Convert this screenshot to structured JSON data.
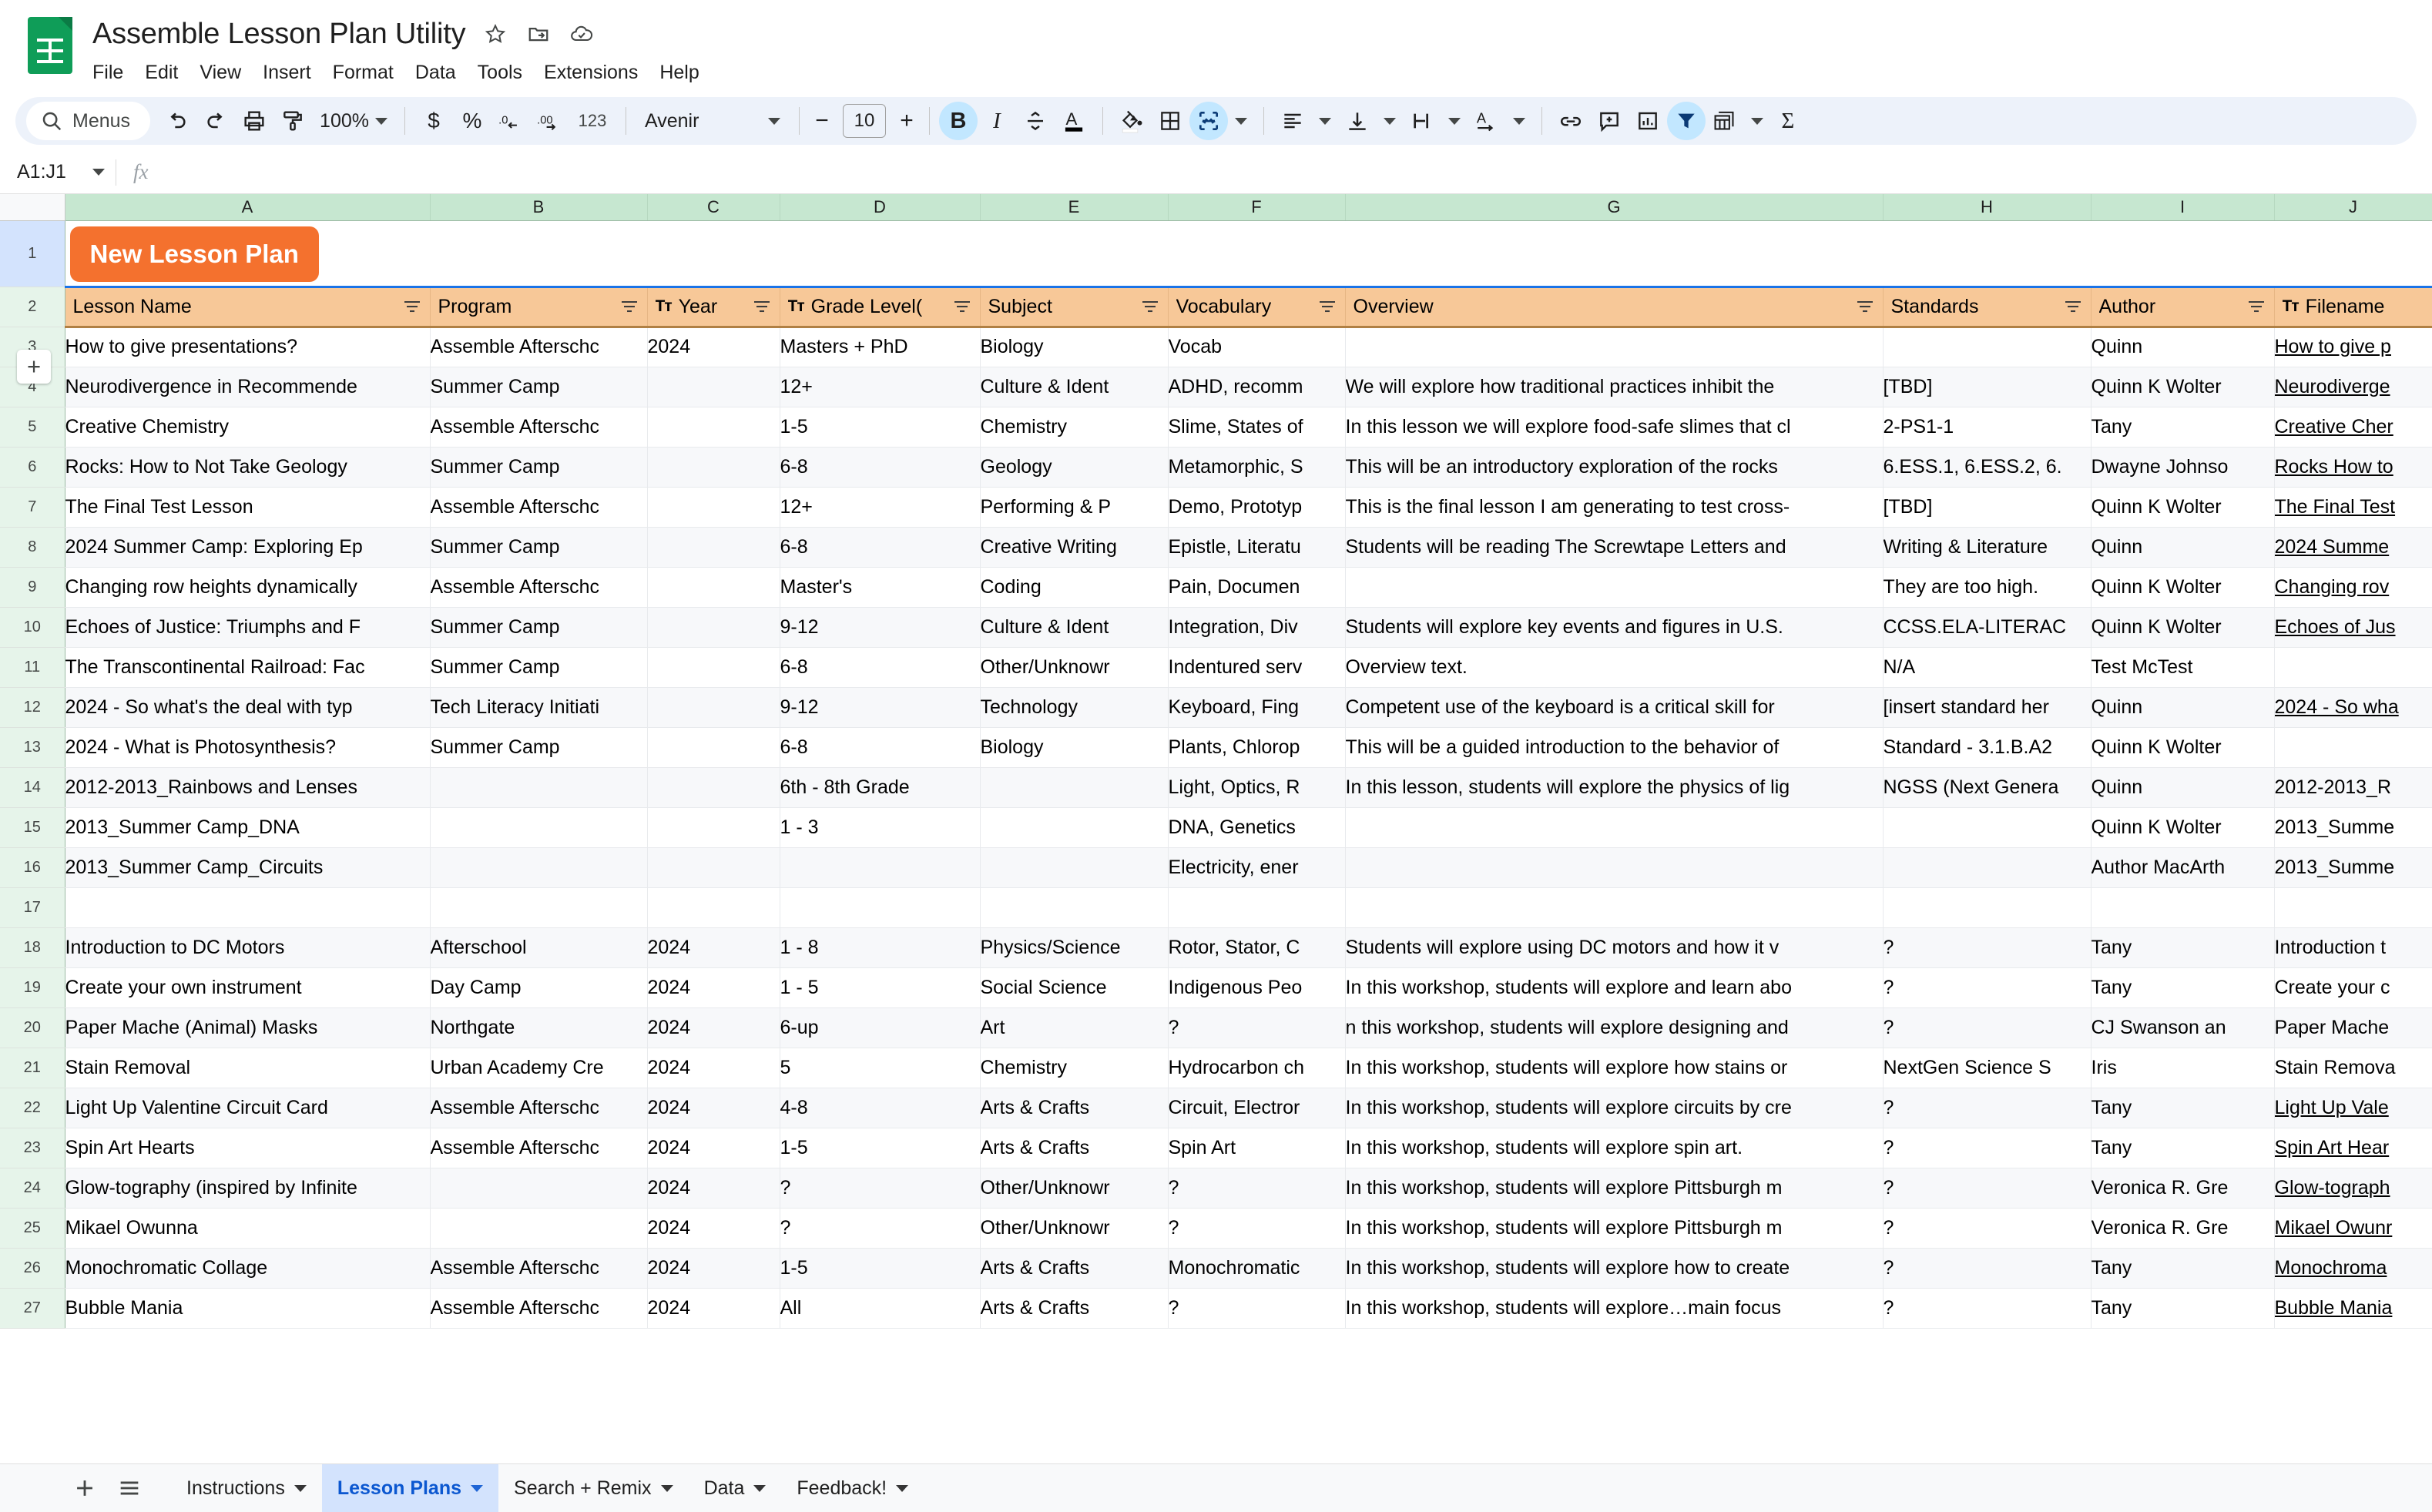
{
  "app": {
    "doc_title": "Assemble Lesson Plan Utility",
    "menus": [
      "File",
      "Edit",
      "View",
      "Insert",
      "Format",
      "Data",
      "Tools",
      "Extensions",
      "Help"
    ],
    "title_icons": [
      "star-icon",
      "move-to-folder-icon",
      "cloud-saved-icon"
    ]
  },
  "toolbar": {
    "menus_label": "Menus",
    "zoom": "100%",
    "font_family_label": "Avenir",
    "font_size": "10",
    "number_format_123": "123",
    "currency": "$",
    "percent": "%",
    "decrease_decimal": ".0",
    "increase_decimal": ".00",
    "bold": "B",
    "italic": "I",
    "bold_active": true,
    "merge_active": true,
    "filter_active": true
  },
  "formula_bar": {
    "name_box": "A1:J1",
    "fx": "fx",
    "value": ""
  },
  "grid": {
    "columns": [
      "A",
      "B",
      "C",
      "D",
      "E",
      "F",
      "G",
      "H",
      "I",
      "J"
    ],
    "banner": {
      "row_number": "1",
      "button_label": "New Lesson Plan",
      "button_color": "#F4712E",
      "button_text_color": "#ffffff"
    },
    "header": {
      "row_number": "2",
      "background": "#f7c898",
      "cells": [
        {
          "label": "Lesson Name",
          "prefix": "",
          "filter": true
        },
        {
          "label": "Program",
          "prefix": "",
          "filter": true
        },
        {
          "label": "Year",
          "prefix": "Tт",
          "filter": true
        },
        {
          "label": "Grade Level(",
          "prefix": "Tт",
          "filter": true
        },
        {
          "label": "Subject",
          "prefix": "",
          "filter": true
        },
        {
          "label": "Vocabulary",
          "prefix": "",
          "filter": true
        },
        {
          "label": "Overview",
          "prefix": "",
          "filter": true
        },
        {
          "label": "Standards",
          "prefix": "",
          "filter": true
        },
        {
          "label": "Author",
          "prefix": "",
          "filter": true
        },
        {
          "label": "Filename",
          "prefix": "Tт",
          "filter": false
        }
      ]
    },
    "rows": [
      {
        "n": "3",
        "cells": [
          "How to give presentations?",
          "Assemble Afterschc",
          "2024",
          "Masters + PhD",
          "Biology",
          "Vocab",
          "",
          "",
          "Quinn",
          "How to give p"
        ],
        "link": true
      },
      {
        "n": "4",
        "cells": [
          "Neurodivergence in Recommende",
          "Summer Camp",
          "",
          "12+",
          "Culture & Ident",
          "ADHD, recomm",
          "We will explore how traditional practices inhibit the",
          "[TBD]",
          "Quinn K Wolter",
          "Neurodiverge"
        ],
        "link": true
      },
      {
        "n": "5",
        "cells": [
          "Creative Chemistry",
          "Assemble Afterschc",
          "",
          "1-5",
          "Chemistry",
          "Slime, States of",
          "In this lesson we will explore food-safe slimes that cl",
          "2-PS1-1",
          "Tany",
          "Creative Cher"
        ],
        "link": true
      },
      {
        "n": "6",
        "cells": [
          "Rocks: How to Not Take Geology ",
          "Summer Camp",
          "",
          "6-8",
          "Geology",
          "Metamorphic, S",
          "This will be an introductory exploration of the rocks",
          "6.ESS.1, 6.ESS.2, 6.",
          "Dwayne Johnso",
          "Rocks How to"
        ],
        "link": true
      },
      {
        "n": "7",
        "cells": [
          "The Final Test Lesson",
          "Assemble Afterschc",
          "",
          "12+",
          "Performing & P",
          "Demo, Prototyp",
          "This is the final lesson I am generating to test cross-",
          "[TBD]",
          "Quinn K Wolter",
          "The Final Test"
        ],
        "link": true
      },
      {
        "n": "8",
        "cells": [
          "2024 Summer Camp: Exploring Ep",
          "Summer Camp",
          "",
          "6-8",
          "Creative Writing",
          "Epistle, Literatu",
          "Students will be reading The Screwtape Letters and",
          "Writing & Literature",
          "Quinn",
          "2024 Summe"
        ],
        "link": true
      },
      {
        "n": "9",
        "cells": [
          "Changing row heights dynamically",
          "Assemble Afterschc",
          "",
          "Master's",
          "Coding",
          "Pain, Documen",
          "",
          "They are too high.",
          "Quinn K Wolter",
          "Changing rov"
        ],
        "link": true
      },
      {
        "n": "10",
        "cells": [
          "Echoes of Justice: Triumphs and F",
          "Summer Camp",
          "",
          "9-12",
          "Culture & Ident",
          "Integration, Div",
          "Students will explore key events and figures in U.S. ",
          "CCSS.ELA-LITERAC",
          "Quinn K Wolter",
          "Echoes of Jus"
        ],
        "link": true
      },
      {
        "n": "11",
        "cells": [
          "The Transcontinental Railroad: Fac",
          "Summer Camp",
          "",
          "6-8",
          "Other/Unknowr",
          "Indentured serv",
          "Overview text.",
          "N/A",
          "Test McTest",
          ""
        ],
        "link": false
      },
      {
        "n": "12",
        "cells": [
          "2024 - So what's the deal with typ",
          "Tech Literacy Initiati",
          "",
          "9-12",
          "Technology",
          "Keyboard, Fing",
          "Competent use of the keyboard is a critical skill for ",
          "[insert standard her",
          "Quinn",
          "2024 - So wha"
        ],
        "link": true
      },
      {
        "n": "13",
        "cells": [
          "2024 - What is Photosynthesis?",
          "Summer Camp",
          "",
          "6-8",
          "Biology",
          "Plants, Chlorop",
          "This will be a guided introduction to the behavior of",
          "Standard - 3.1.B.A2",
          "Quinn K Wolter",
          ""
        ],
        "link": false
      },
      {
        "n": "14",
        "cells": [
          "2012-2013_Rainbows and Lenses ",
          "",
          "",
          "6th - 8th Grade",
          "",
          "Light, Optics, R",
          "In this lesson, students will explore the physics of lig",
          "NGSS (Next Genera",
          "Quinn",
          "2012-2013_R"
        ],
        "link": false
      },
      {
        "n": "15",
        "cells": [
          "2013_Summer Camp_DNA",
          "",
          "",
          "1 - 3",
          "",
          "DNA, Genetics",
          "",
          "",
          "Quinn K Wolter",
          "2013_Summe"
        ],
        "link": false
      },
      {
        "n": "16",
        "cells": [
          "2013_Summer Camp_Circuits",
          "",
          "",
          "",
          "",
          "Electricity, ener",
          "",
          "",
          "Author MacArth",
          "2013_Summe"
        ],
        "link": false
      },
      {
        "n": "17",
        "cells": [
          "",
          "",
          "",
          "",
          "",
          "",
          "",
          "",
          "",
          ""
        ],
        "link": false
      },
      {
        "n": "18",
        "cells": [
          "Introduction to DC Motors",
          "Afterschool",
          "2024",
          "1 - 8",
          "Physics/Science",
          "Rotor, Stator, C",
          "Students will explore using  DC motors  and how it v",
          "?",
          "Tany",
          "Introduction t"
        ],
        "link": false
      },
      {
        "n": "19",
        "cells": [
          "Create your own instrument",
          "Day Camp",
          "2024",
          "1 - 5",
          "Social Science",
          "Indigenous Peo",
          "In this workshop, students will explore and learn abo",
          "?",
          "Tany",
          "Create your c"
        ],
        "link": false
      },
      {
        "n": "20",
        "cells": [
          "Paper Mache (Animal) Masks",
          "Northgate",
          "2024",
          "6-up",
          "Art",
          "?",
          "n this workshop, students will explore designing and",
          "?",
          "CJ Swanson an",
          "Paper Mache"
        ],
        "link": false
      },
      {
        "n": "21",
        "cells": [
          "Stain Removal",
          "Urban Academy Cre",
          "2024",
          "5",
          "Chemistry",
          "Hydrocarbon ch",
          "In this workshop, students will explore how stains or",
          "NextGen Science S",
          "Iris",
          "Stain Remova"
        ],
        "link": false
      },
      {
        "n": "22",
        "cells": [
          "Light Up Valentine Circuit Card",
          "Assemble Afterschc",
          "2024",
          "4-8",
          "Arts & Crafts",
          "Circuit, Electror",
          "In this workshop, students will explore circuits by cre",
          "?",
          "Tany",
          "Light Up Vale"
        ],
        "link": true
      },
      {
        "n": "23",
        "cells": [
          "Spin Art Hearts",
          "Assemble Afterschc",
          "2024",
          "1-5",
          "Arts & Crafts",
          "Spin Art",
          "In this workshop, students will explore spin art.",
          "?",
          "Tany",
          "Spin Art Hear"
        ],
        "link": true
      },
      {
        "n": "24",
        "cells": [
          "Glow-tography (inspired by Infinite",
          "",
          "2024",
          "?",
          "Other/Unknowr",
          "?",
          "In this workshop, students will explore Pittsburgh m",
          "?",
          "Veronica R. Gre",
          "Glow-tograph"
        ],
        "link": true
      },
      {
        "n": "25",
        "cells": [
          "Mikael Owunna",
          "",
          "2024",
          "?",
          "Other/Unknowr",
          "?",
          "In this workshop, students will explore Pittsburgh m",
          "?",
          "Veronica R. Gre",
          "Mikael Owunr"
        ],
        "link": true
      },
      {
        "n": "26",
        "cells": [
          "Monochromatic Collage",
          "Assemble Afterschc",
          "2024",
          "1-5",
          "Arts & Crafts",
          "Monochromatic",
          "In this workshop, students will explore how to create",
          "?",
          " Tany",
          "Monochroma"
        ],
        "link": true
      },
      {
        "n": "27",
        "cells": [
          "Bubble Mania",
          "Assemble Afterschc",
          "2024",
          "All",
          "Arts & Crafts",
          "?",
          "In this workshop, students will explore…main focus",
          "?",
          "Tany",
          "Bubble Mania"
        ],
        "link": true
      }
    ]
  },
  "tabbar": {
    "add_label": "+",
    "all_sheets_label": "all-sheets-icon",
    "tabs": [
      {
        "label": "Instructions",
        "active": false
      },
      {
        "label": "Lesson Plans",
        "active": true
      },
      {
        "label": "Search + Remix",
        "active": false
      },
      {
        "label": "Data",
        "active": false
      },
      {
        "label": "Feedback!",
        "active": false
      }
    ]
  }
}
